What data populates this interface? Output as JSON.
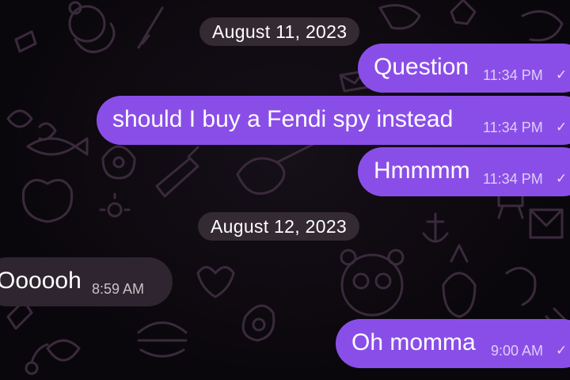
{
  "dates": [
    {
      "label": "August 11, 2023"
    },
    {
      "label": "August 12, 2023"
    }
  ],
  "messages": [
    {
      "direction": "outgoing",
      "text": "Question",
      "time": "11:34 PM",
      "status_icon": "check-icon"
    },
    {
      "direction": "outgoing",
      "text": "should I buy a Fendi spy instead",
      "time": "11:34 PM",
      "status_icon": "check-icon"
    },
    {
      "direction": "outgoing",
      "text": "Hmmmm",
      "time": "11:34 PM",
      "status_icon": "check-icon"
    },
    {
      "direction": "incoming",
      "text": "Oooooh",
      "time": "8:59 AM"
    },
    {
      "direction": "outgoing",
      "text": "Oh momma",
      "time": "9:00 AM",
      "status_icon": "check-icon"
    }
  ],
  "colors": {
    "background": "#0a070c",
    "outgoing_bubble": "#8a4ee8",
    "incoming_bubble": "#2f2530",
    "date_pill": "#3a3038",
    "doodle_stroke": "#3a2a3c",
    "text": "#ffffff"
  },
  "icons": {
    "check": "✓"
  }
}
